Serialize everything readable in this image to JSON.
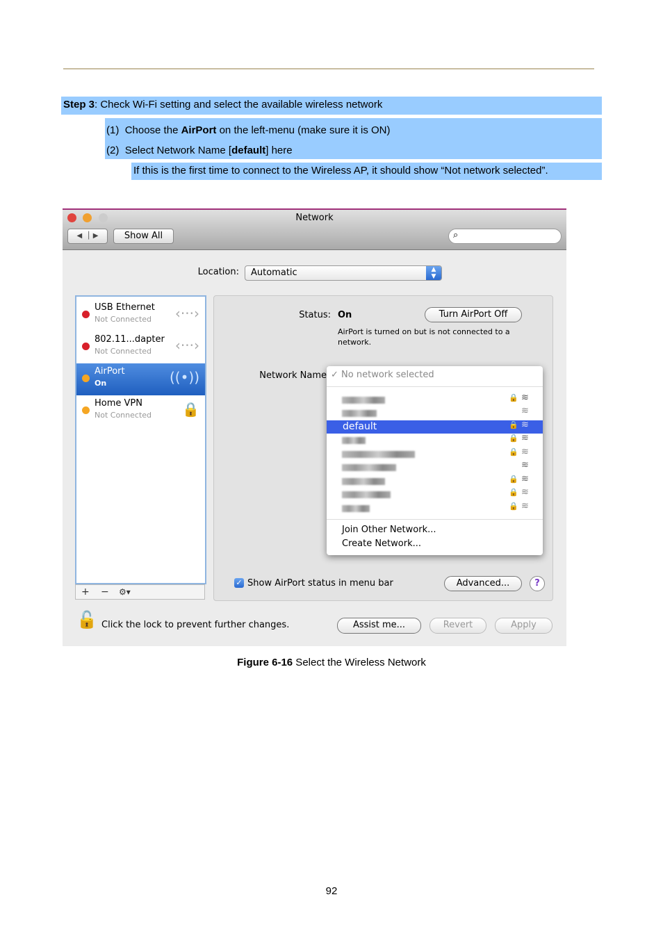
{
  "instructions": {
    "step_label": "Step 3",
    "step_text": ": Check Wi-Fi setting and select the available wireless network",
    "items": [
      {
        "num": "(1)",
        "pre": "Choose the ",
        "bold": "AirPort",
        "post": " on the left-menu (make sure it is ON)"
      },
      {
        "num": "(2)",
        "pre": "Select Network Name [",
        "bold": "default",
        "post": "] here"
      }
    ],
    "note": "If this is the first time to connect to the Wireless AP, it should show “Not network selected”."
  },
  "window": {
    "title": "Network",
    "show_all": "Show All",
    "search_placeholder": "",
    "location_label": "Location:",
    "location_value": "Automatic",
    "services": [
      {
        "name": "USB Ethernet",
        "status": "Not Connected",
        "dot": "#d8202a",
        "icon": "ethernet-icon"
      },
      {
        "name": "802.11...dapter",
        "status": "Not Connected",
        "dot": "#d8202a",
        "icon": "ethernet-icon"
      },
      {
        "name": "AirPort",
        "status": "On",
        "dot": "#f5a623",
        "icon": "wifi-icon",
        "selected": true
      },
      {
        "name": "Home VPN",
        "status": "Not Connected",
        "dot": "#f5a623",
        "icon": "vpn-lock-icon"
      }
    ],
    "status_label": "Status:",
    "status_value": "On",
    "turn_off": "Turn AirPort Off",
    "status_desc": "AirPort is turned on but is not connected to a network.",
    "network_name_label": "Network Name",
    "menu": {
      "current": "No network selected",
      "networks": [
        {
          "name": "",
          "lock": true
        },
        {
          "name": "",
          "lock": false
        },
        {
          "name": "default",
          "lock": true,
          "highlighted": true
        },
        {
          "name": "",
          "lock": true
        },
        {
          "name": "",
          "lock": true
        },
        {
          "name": "",
          "lock": false
        },
        {
          "name": "",
          "lock": true
        },
        {
          "name": "",
          "lock": true
        },
        {
          "name": "",
          "lock": true
        }
      ],
      "join_other": "Join Other Network...",
      "create": "Create Network..."
    },
    "show_status": "Show AirPort status in menu bar",
    "show_status_checked": true,
    "advanced": "Advanced...",
    "lock_text": "Click the lock to prevent further changes.",
    "assist": "Assist me...",
    "revert": "Revert",
    "apply": "Apply"
  },
  "caption": {
    "bold": "Figure 6-16",
    "text": " Select the Wireless Network"
  },
  "page_number": "92"
}
